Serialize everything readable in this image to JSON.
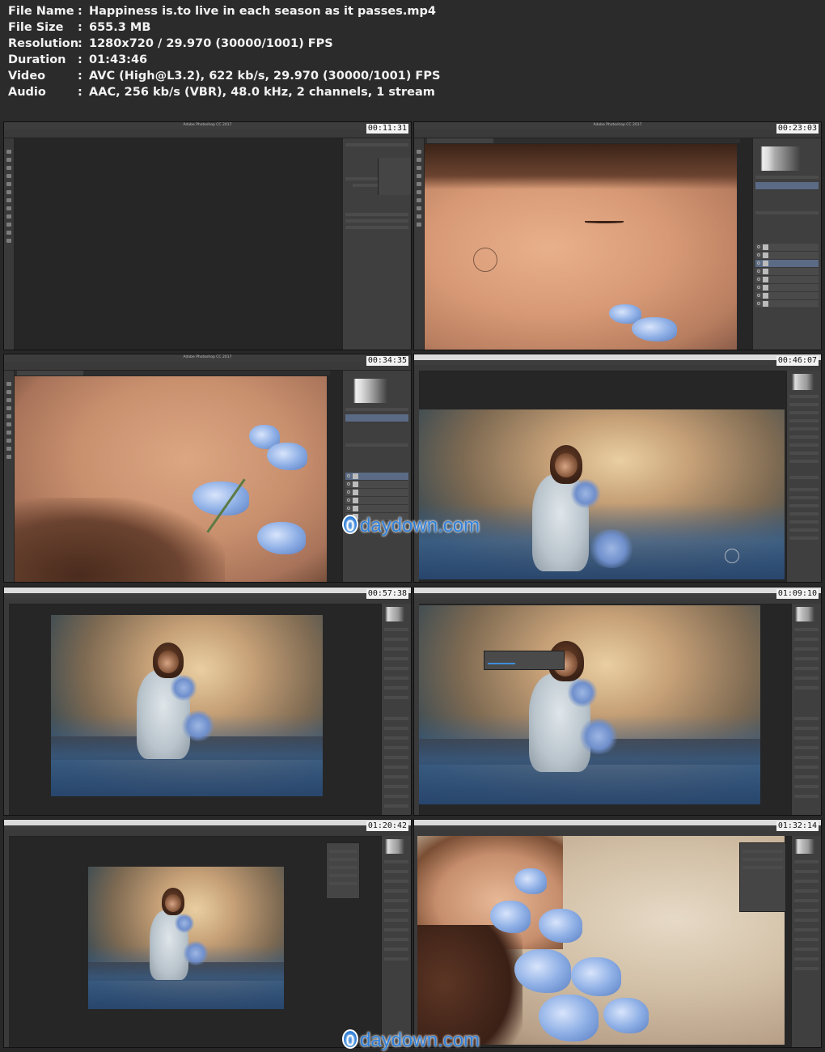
{
  "file_info": {
    "rows": [
      {
        "key": "File Name",
        "colon": ":",
        "value": "Happiness is.to live in each season as it passes.mp4"
      },
      {
        "key": "File Size",
        "colon": ":",
        "value": "655.3 MB"
      },
      {
        "key": "Resolution",
        "colon": ":",
        "value": "1280x720 / 29.970 (30000/1001) FPS"
      },
      {
        "key": "Duration",
        "colon": ":",
        "value": "01:43:46"
      },
      {
        "key": "Video",
        "colon": ":",
        "value": "AVC (High@L3.2), 622 kb/s, 29.970 (30000/1001) FPS"
      },
      {
        "key": "Audio",
        "colon": ":",
        "value": "AAC, 256 kb/s (VBR), 48.0 kHz, 2 channels, 1 stream"
      }
    ]
  },
  "app_title": "Adobe Photoshop CC 2017",
  "frames": [
    {
      "timestamp": "00:11:31",
      "scene": "empty"
    },
    {
      "timestamp": "00:23:03",
      "scene": "eye-closeup"
    },
    {
      "timestamp": "00:34:35",
      "scene": "cheek-flowers"
    },
    {
      "timestamp": "00:46:07",
      "scene": "girl-full"
    },
    {
      "timestamp": "00:57:38",
      "scene": "girl-full"
    },
    {
      "timestamp": "01:09:10",
      "scene": "girl-full"
    },
    {
      "timestamp": "01:20:42",
      "scene": "girl-small"
    },
    {
      "timestamp": "01:32:14",
      "scene": "face-flowers"
    }
  ],
  "watermark": {
    "badge": "0",
    "text": "daydown.com"
  },
  "colors": {
    "background": "#282828",
    "info_text": "#f2f2f2",
    "watermark": "#2f7fd8"
  }
}
